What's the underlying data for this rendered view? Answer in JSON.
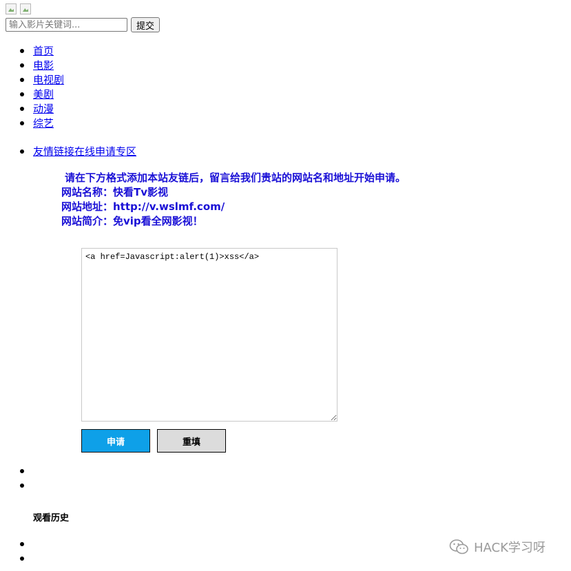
{
  "header": {
    "search": {
      "placeholder": "输入影片关键词...",
      "value": ""
    },
    "submit_label": "提交"
  },
  "nav": {
    "items": [
      {
        "label": "首页"
      },
      {
        "label": "电影"
      },
      {
        "label": "电视剧"
      },
      {
        "label": "美剧"
      },
      {
        "label": "动漫"
      },
      {
        "label": "综艺"
      }
    ]
  },
  "section": {
    "link_label": "友情链接在线申请专区"
  },
  "info": {
    "line1": "请在下方格式添加本站友链后，留言给我们贵站的网站名和地址开始申请。",
    "line2": "网站名称：快看Tv影视",
    "line3": "网站地址：http://v.wslmf.com/",
    "line4": "网站简介：免vip看全网影视！"
  },
  "form": {
    "textarea_value": "<a href=Javascript:alert(1)>xss</a>",
    "apply_label": "申请",
    "reset_label": "重填"
  },
  "history": {
    "title": "观看历史"
  },
  "watermark": {
    "text": "HACK学习呀",
    "icon": "wechat-icon"
  }
}
